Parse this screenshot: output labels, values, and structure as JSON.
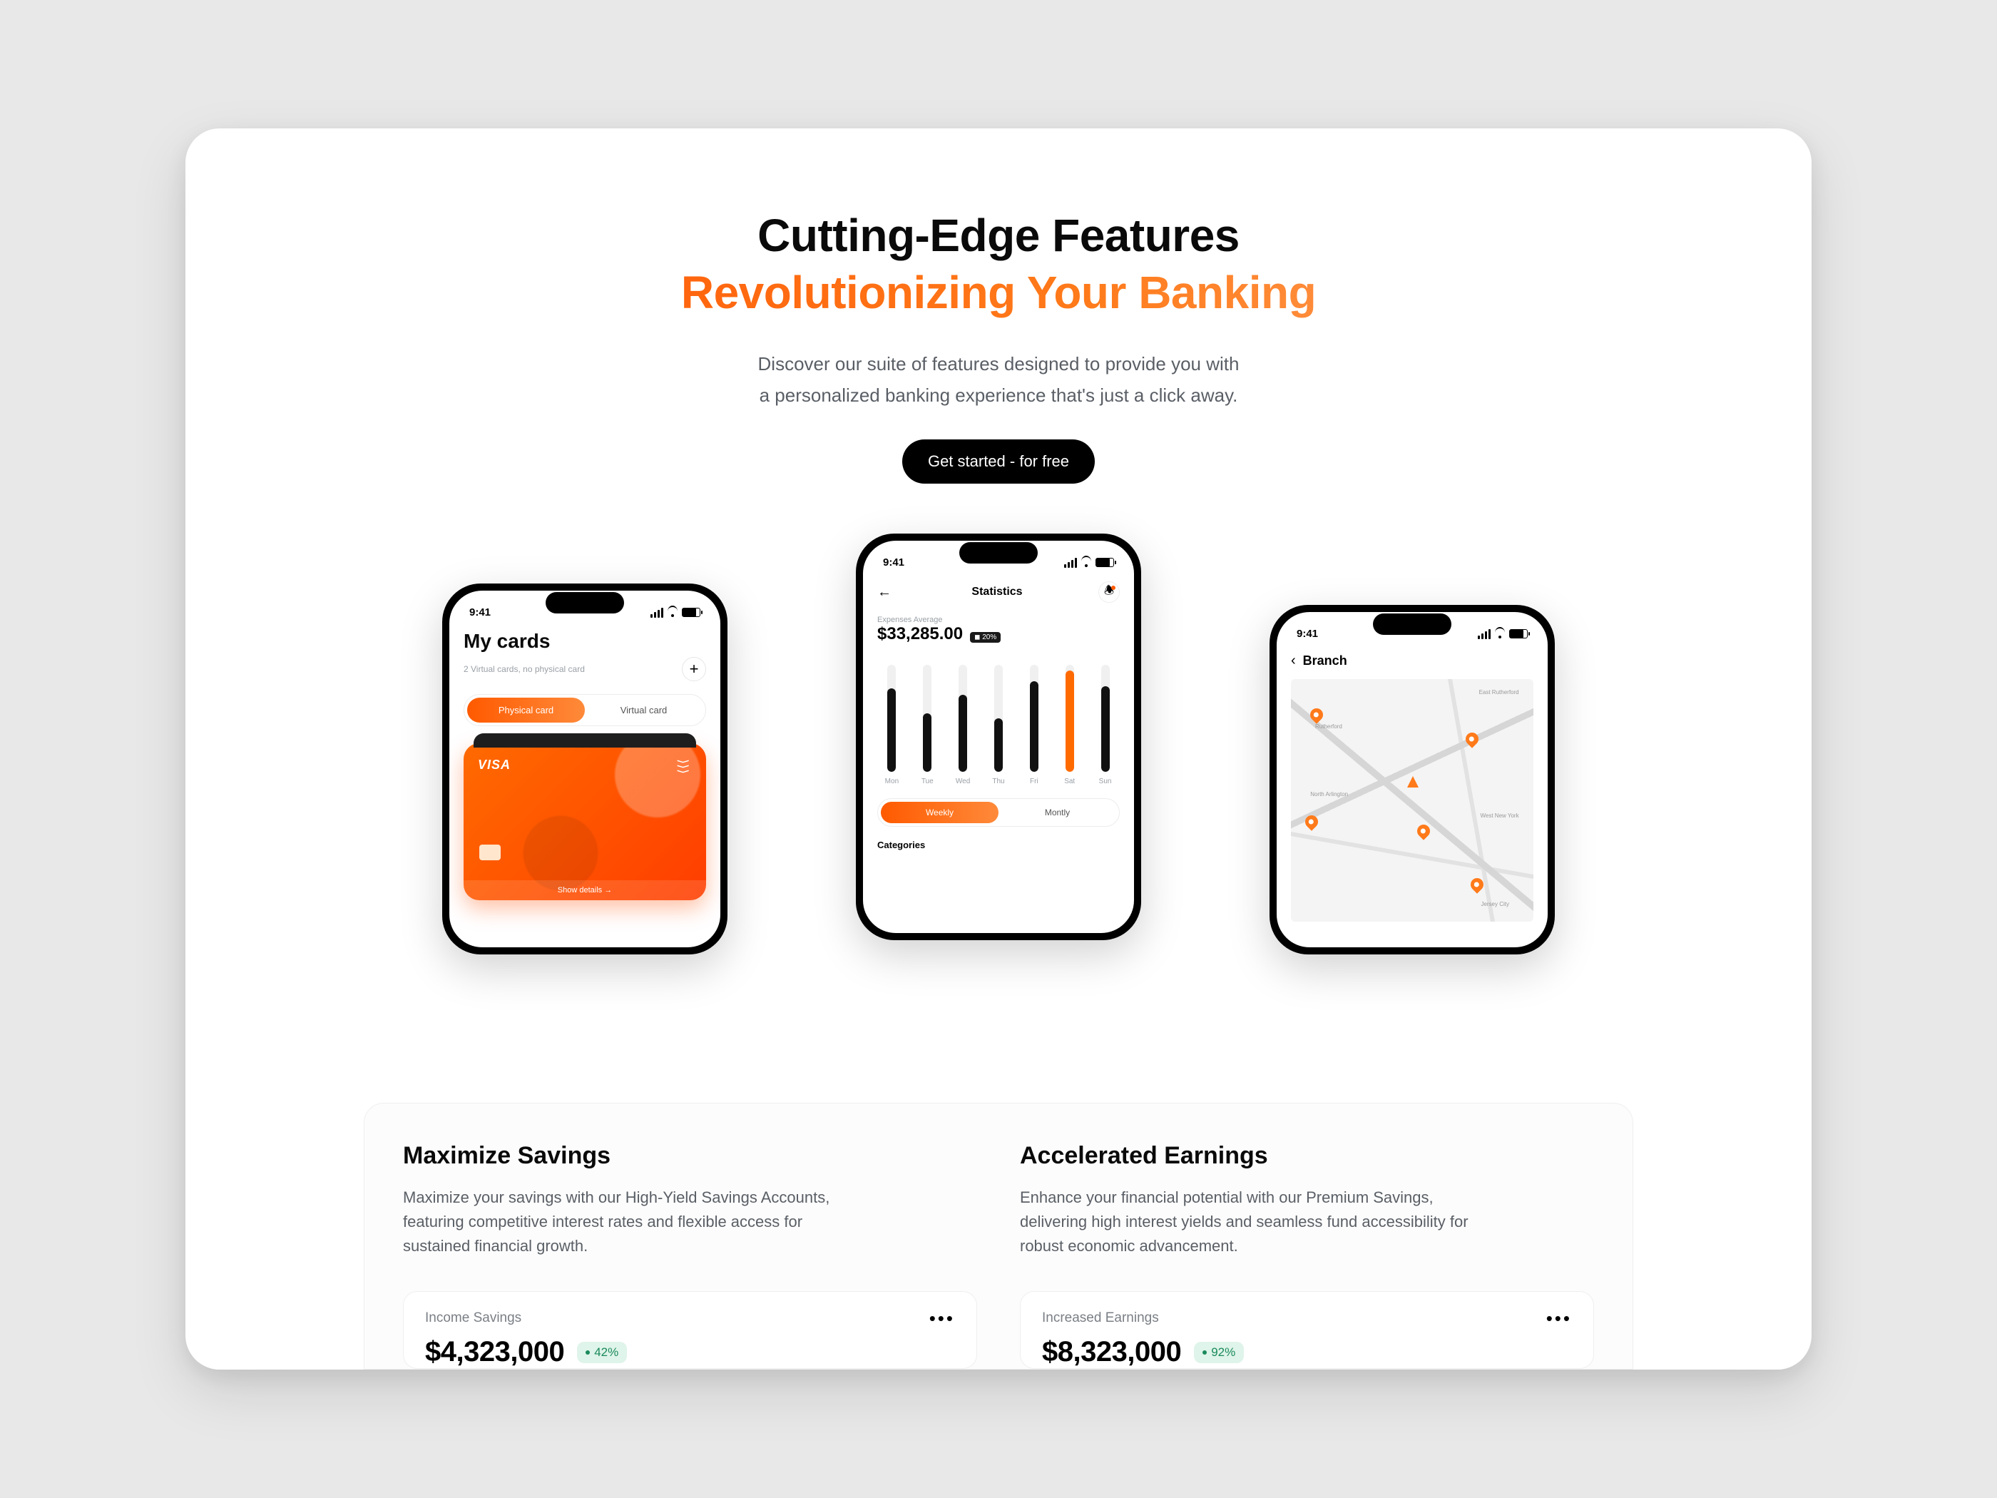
{
  "hero": {
    "title_line1": "Cutting-Edge Features",
    "title_line2": "Revolutionizing Your Banking",
    "sub_line1": "Discover our suite of features designed to provide you with",
    "sub_line2": "a personalized banking experience that's just a click away.",
    "cta": "Get started - for free"
  },
  "phone1": {
    "time": "9:41",
    "title": "My cards",
    "subtitle": "2 Virtual cards, no physical card",
    "add_plus": "+",
    "seg_physical": "Physical card",
    "seg_virtual": "Virtual card",
    "card_brand": "VISA",
    "nfc_glyph": "⟩⟩⟩",
    "show_details": "Show details  →"
  },
  "phone2": {
    "time": "9:41",
    "back_glyph": "←",
    "title": "Statistics",
    "bell_glyph": "♧",
    "expenses_label": "Expenses Average",
    "expenses_value": "$33,285.00",
    "delta": "◼ 20%",
    "bars": [
      {
        "label": "Mon",
        "pct": 78,
        "color": "#111"
      },
      {
        "label": "Tue",
        "pct": 55,
        "color": "#111"
      },
      {
        "label": "Wed",
        "pct": 72,
        "color": "#111"
      },
      {
        "label": "Thu",
        "pct": 50,
        "color": "#111"
      },
      {
        "label": "Fri",
        "pct": 85,
        "color": "#111"
      },
      {
        "label": "Sat",
        "pct": 95,
        "color": "#ff6a00"
      },
      {
        "label": "Sun",
        "pct": 80,
        "color": "#111"
      }
    ],
    "seg_weekly": "Weekly",
    "seg_monthly": "Montly",
    "categories_label": "Categories"
  },
  "phone3": {
    "time": "9:41",
    "back_glyph": "‹",
    "title": "Branch",
    "map_labels": {
      "a": "East Rutherford",
      "b": "Rutherford",
      "c": "North Arlington",
      "d": "West New York",
      "e": "Jersey City"
    }
  },
  "features": [
    {
      "heading": "Maximize Savings",
      "body": "Maximize your savings with our High-Yield Savings Accounts, featuring competitive interest rates and flexible access for sustained financial growth.",
      "stat_label": "Income Savings",
      "stat_value": "$4,323,000",
      "stat_badge": "42%",
      "dots": "•••"
    },
    {
      "heading": "Accelerated Earnings",
      "body": "Enhance your financial potential with our Premium Savings, delivering high interest yields and seamless fund accessibility for robust economic advancement.",
      "stat_label": "Increased Earnings",
      "stat_value": "$8,323,000",
      "stat_badge": "92%",
      "dots": "•••"
    }
  ]
}
